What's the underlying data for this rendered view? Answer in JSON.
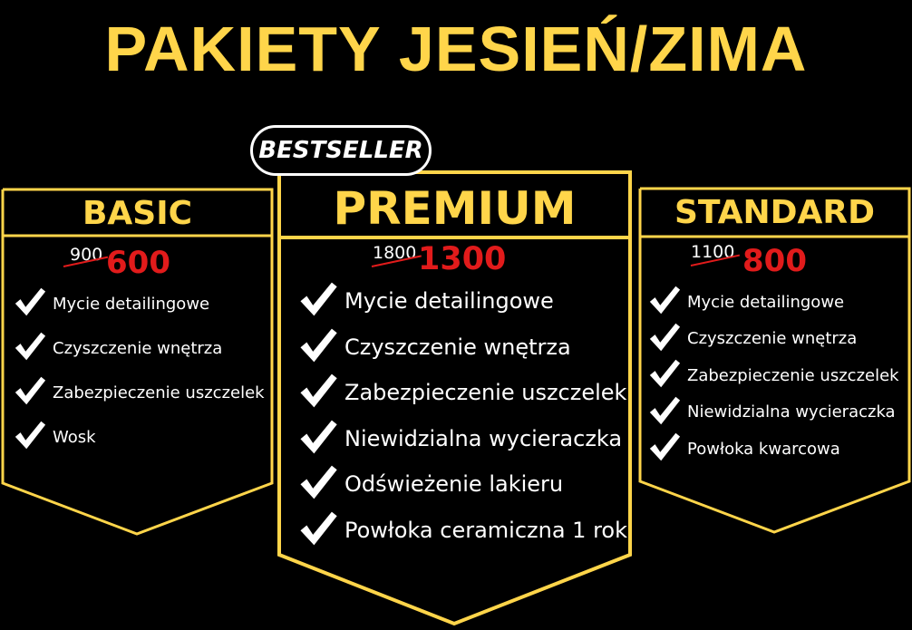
{
  "title": "PAKIETY JESIEŃ/ZIMA",
  "badge": "BESTSELLER",
  "accent_color": "#FFD54A",
  "price_color": "#E11B1B",
  "check_icon": "check-icon",
  "cards": {
    "basic": {
      "name": "BASIC",
      "old_price": "900",
      "new_price": "600",
      "features": [
        "Mycie detailingowe",
        "Czyszczenie wnętrza",
        "Zabezpieczenie uszczelek",
        "Wosk"
      ]
    },
    "premium": {
      "name": "PREMIUM",
      "old_price": "1800",
      "new_price": "1300",
      "features": [
        "Mycie detailingowe",
        "Czyszczenie wnętrza",
        "Zabezpieczenie uszczelek",
        "Niewidzialna wycieraczka",
        "Odświeżenie lakieru",
        "Powłoka ceramiczna 1 rok"
      ]
    },
    "standard": {
      "name": "STANDARD",
      "old_price": "1100",
      "new_price": "800",
      "features": [
        "Mycie detailingowe",
        "Czyszczenie wnętrza",
        "Zabezpieczenie uszczelek",
        "Niewidzialna wycieraczka",
        "Powłoka kwarcowa"
      ]
    }
  }
}
